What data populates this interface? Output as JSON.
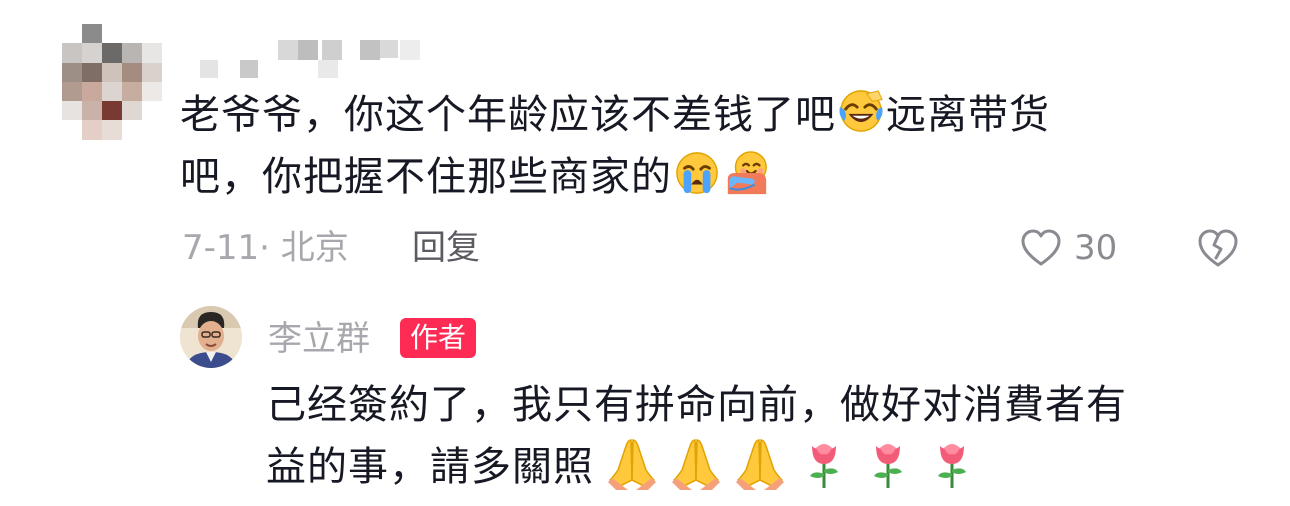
{
  "comment": {
    "text_line1": "老爷爷，你这个年龄应该不差钱了吧",
    "text_line1b": "远离带货",
    "text_line2": "吧，你把握不住那些商家的",
    "emojis": [
      "laughing-tears-icon",
      "crying-icon",
      "hug-icon"
    ],
    "meta": "7-11· 北京",
    "reply_label": "回复",
    "like_count": "30"
  },
  "reply": {
    "author_name": "李立群",
    "author_badge": "作者",
    "text_line1": "己经簽約了，我只有拼命向前，做好对消費者有",
    "text_line2": "益的事，請多關照",
    "emojis": [
      "praying-hands-icon",
      "praying-hands-icon",
      "praying-hands-icon",
      "rose-icon",
      "rose-icon",
      "rose-icon"
    ]
  },
  "colors": {
    "text": "#161823",
    "meta": "#a7a8ad",
    "badge": "#fe2c55"
  }
}
